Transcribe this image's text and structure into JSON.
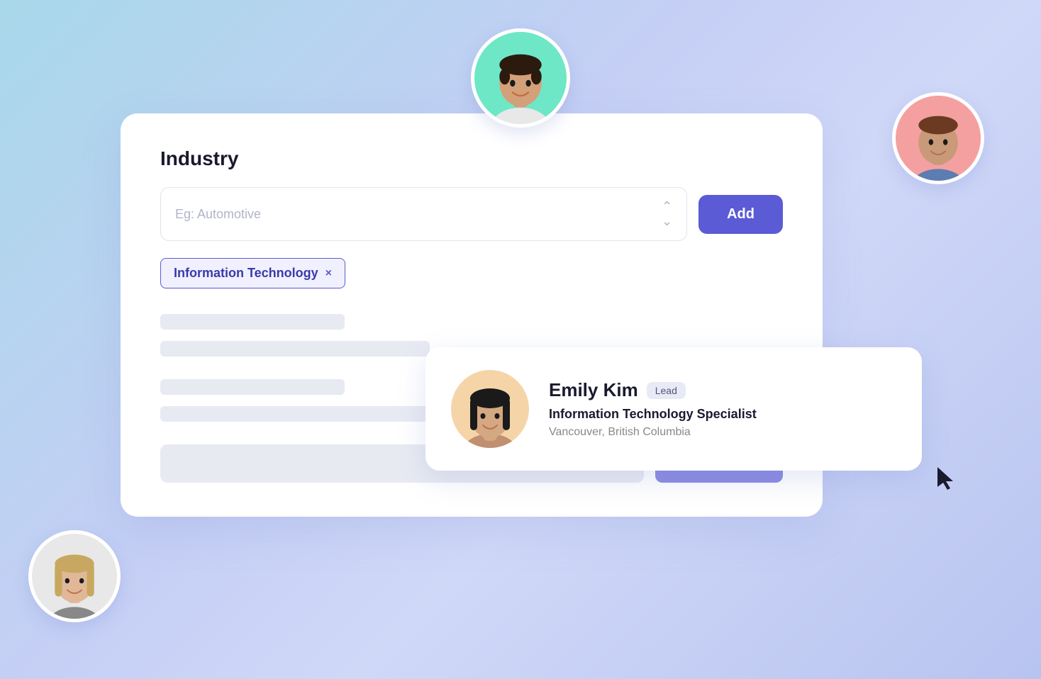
{
  "page": {
    "background": "gradient-blue-purple"
  },
  "main_card": {
    "industry_label": "Industry",
    "input_placeholder": "Eg: Automotive",
    "add_button_label": "Add",
    "selected_tag": "Information Technology",
    "tag_close_label": "×"
  },
  "profile_card": {
    "name": "Emily Kim",
    "badge": "Lead",
    "title": "Information Technology Specialist",
    "location": "Vancouver, British Columbia"
  },
  "avatars": {
    "top_center_bg": "#6ee7c7",
    "top_right_bg": "#f4a0a0",
    "bottom_left_bg": "#e8e8e8",
    "profile_bg": "#f5d5a8"
  }
}
